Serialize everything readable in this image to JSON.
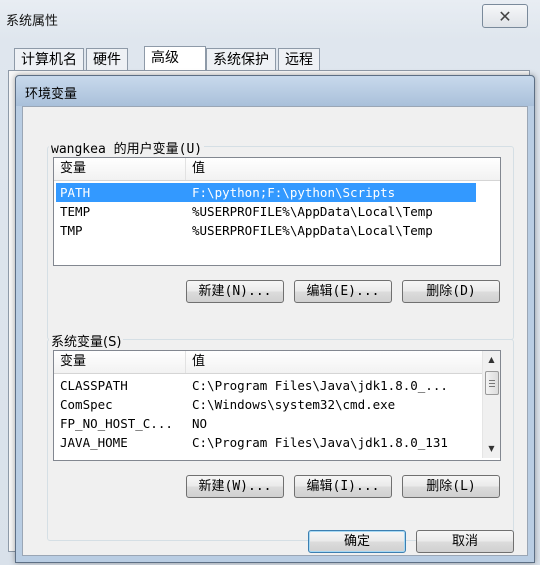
{
  "outer_window": {
    "title": "系统属性",
    "close_glyph": "✕",
    "tabs": [
      {
        "label": "计算机名"
      },
      {
        "label": "硬件"
      },
      {
        "label": "高级"
      },
      {
        "label": "系统保护"
      },
      {
        "label": "远程"
      }
    ]
  },
  "dialog": {
    "title": "环境变量",
    "user_vars": {
      "group_label": "wangkea 的用户变量(U)",
      "columns": [
        "变量",
        "值"
      ],
      "rows": [
        {
          "name": "PATH",
          "value": "F:\\python;F:\\python\\Scripts"
        },
        {
          "name": "TEMP",
          "value": "%USERPROFILE%\\AppData\\Local\\Temp"
        },
        {
          "name": "TMP",
          "value": "%USERPROFILE%\\AppData\\Local\\Temp"
        }
      ],
      "buttons": {
        "new": "新建(N)...",
        "edit": "编辑(E)...",
        "delete": "删除(D)"
      }
    },
    "system_vars": {
      "group_label": "系统变量(S)",
      "columns": [
        "变量",
        "值"
      ],
      "rows": [
        {
          "name": "CLASSPATH",
          "value": "C:\\Program Files\\Java\\jdk1.8.0_..."
        },
        {
          "name": "ComSpec",
          "value": "C:\\Windows\\system32\\cmd.exe"
        },
        {
          "name": "FP_NO_HOST_C...",
          "value": "NO"
        },
        {
          "name": "JAVA_HOME",
          "value": "C:\\Program Files\\Java\\jdk1.8.0_131"
        }
      ],
      "buttons": {
        "new": "新建(W)...",
        "edit": "编辑(I)...",
        "delete": "删除(L)"
      }
    },
    "footer": {
      "ok": "确定",
      "cancel": "取消"
    }
  },
  "icons": {
    "scroll_up": "▲",
    "scroll_down": "▼"
  },
  "colors": {
    "selection": "#3399ff",
    "dialog_frame": "#b9cde3"
  }
}
